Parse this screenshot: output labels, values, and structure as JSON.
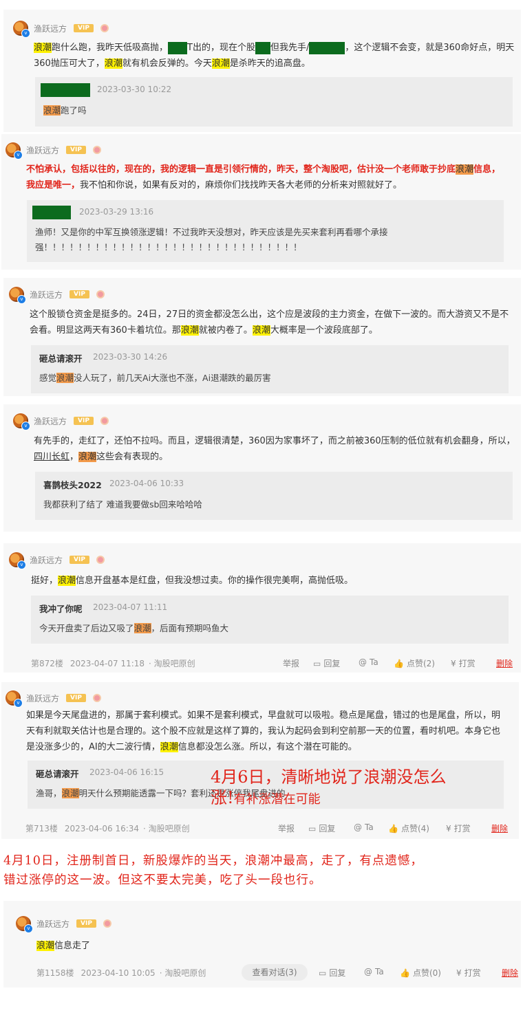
{
  "user": {
    "name": "渔跃远方",
    "vip": "VIP"
  },
  "posts": [
    {
      "body": [
        {
          "t": "浪潮",
          "s": "hl"
        },
        {
          "t": "跑什么跑，我昨天低吸高抛，"
        },
        {
          "t": "",
          "s": "censor",
          "w": 28
        },
        {
          "t": "T出的，现在个股"
        },
        {
          "t": "",
          "s": "censor",
          "w": 22
        },
        {
          "t": "但我先手/"
        },
        {
          "t": "",
          "s": "censor",
          "w": 52
        },
        {
          "t": "，这个逻辑不会变，就是360命好点，明天360抛压可大了，"
        },
        {
          "t": "浪潮",
          "s": "hl"
        },
        {
          "t": "就有机会反弹的。今天"
        },
        {
          "t": "浪潮",
          "s": "hl"
        },
        {
          "t": "是杀昨天的追高盘。"
        }
      ],
      "reply": {
        "time": "2023-03-30 10:22",
        "body": [
          {
            "t": "浪潮",
            "s": "hlo"
          },
          {
            "t": "跑了吗"
          }
        ]
      }
    },
    {
      "body": [
        {
          "t": "不怕承认，包括以往的，现在的，我的逻辑一直是引领行情的，昨天，整个淘股吧，估计没一个老师敢于抄底",
          "s": "red"
        },
        {
          "t": "浪潮",
          "s": "hlo"
        },
        {
          "t": "信息，我应是唯一，",
          "s": "red"
        },
        {
          "t": "我不怕和你说，如果有反对的，麻烦你们找找昨天各大老师的分析来对照就好了。"
        }
      ],
      "reply": {
        "time": "2023-03-29 13:16",
        "body": [
          {
            "t": "渔师！又是你的中军互换领涨逻辑！不过我昨天没想对，昨天应该是先买来套利再看哪个承接强！！！！！！！！！！！！！！！！！！！！！！！！！！！！！！"
          }
        ]
      }
    },
    {
      "body": [
        {
          "t": "这个股锁仓资金是挺多的。24日，27日的资金都没怎么出，这个应是波段的主力资金，在做下一波的。而大游资又不是不会看。明显这两天有360卡着坑位。那"
        },
        {
          "t": "浪潮",
          "s": "hl"
        },
        {
          "t": "就被内卷了。"
        },
        {
          "t": "浪潮",
          "s": "hl"
        },
        {
          "t": "大概率是一个波段底部了。"
        }
      ],
      "reply": {
        "name": "砸总请滚开",
        "time": "2023-03-30 14:26",
        "body": [
          {
            "t": "感觉"
          },
          {
            "t": "浪潮",
            "s": "hlo"
          },
          {
            "t": "没人玩了，前几天Ai大涨也不涨，Ai退潮跌的最厉害"
          }
        ]
      }
    },
    {
      "body": [
        {
          "t": "有先手的，走红了，还怕不拉吗。而且，逻辑很清楚，360因为家事坏了，而之前被360压制的低位就有机会翻身，所以，"
        },
        {
          "t": "四川长虹",
          "s": "link"
        },
        {
          "t": "，"
        },
        {
          "t": "浪潮",
          "s": "hlo"
        },
        {
          "t": "这些会有表现的。"
        }
      ],
      "reply": {
        "name": "喜鹊枝头2022",
        "time": "2023-04-06 10:33",
        "body": [
          {
            "t": "我都获利了结了 难道我要做sb回来哈哈哈"
          }
        ]
      }
    },
    {
      "body": [
        {
          "t": "挺好，"
        },
        {
          "t": "浪潮",
          "s": "hl"
        },
        {
          "t": "信息开盘基本是红盘，但我没想过卖。你的操作很完美啊，高抛低吸。"
        }
      ],
      "reply": {
        "name": "我冲了你呢",
        "time": "2023-04-07 11:11",
        "body": [
          {
            "t": "今天开盘卖了后边又吸了"
          },
          {
            "t": "浪潮",
            "s": "hlo"
          },
          {
            "t": "，后面有预期吗鱼大"
          }
        ]
      },
      "footer": {
        "floor": "第872楼",
        "time": "2023-04-07 11:18",
        "source": "· 淘股吧原创",
        "report": "举报",
        "reply": "回复",
        "at": "Ta",
        "like": "点赞(2)",
        "tip": "打赏",
        "delete": "删除"
      }
    },
    {
      "body": [
        {
          "t": "如果是今天尾盘进的，那属于套利模式。如果不是套利模式，早盘就可以吸啦。稳点是尾盘，错过的也是尾盘，所以，明天有利就取关估计也是合理的。这个股不应就是这样了算的，我认为起码会到利空前那一天的位置，看时机吧。本身它也是没涨多少的，AI的大二波行情，"
        },
        {
          "t": "浪潮",
          "s": "hl"
        },
        {
          "t": "信息都没怎么涨。所以，有这个潜在可能的。"
        }
      ],
      "reply": {
        "name": "砸总请滚开",
        "time": "2023-04-06 16:15",
        "body": [
          {
            "t": "渔哥，"
          },
          {
            "t": "浪潮",
            "s": "hlo"
          },
          {
            "t": "明天什么预期能透露一下吗？套利还是涨停我尾盘进的"
          }
        ]
      },
      "footer": {
        "floor": "第713楼",
        "time": "2023-04-06 16:34",
        "source": "· 淘股吧原创",
        "report": "举报",
        "reply": "回复",
        "at": "Ta",
        "like": "点赞(4)",
        "tip": "打赏",
        "delete": "删除"
      }
    },
    {
      "body": [
        {
          "t": "浪潮",
          "s": "hl"
        },
        {
          "t": "信息走了"
        }
      ],
      "footer": {
        "floor": "第1158楼",
        "time": "2023-04-10 10:05",
        "source": "· 淘股吧原创",
        "chat": "查看对话(3)",
        "reply": "回复",
        "at": "Ta",
        "like": "点赞(0)",
        "tip": "打赏",
        "delete": "删除"
      }
    }
  ],
  "annotations": {
    "a1_line1": "4月6日，清晰地说了浪潮没怎么",
    "a1_line2a": "涨!",
    "a1_line2b": "有补涨潜在可能",
    "a2_line1": "4月10日，注册制首日，新股爆炸的当天，浪潮冲最高，走了，有点遗憾，",
    "a2_line2": "错过涨停的这一波。但这不要太完美，吃了头一段也行。"
  },
  "colors": {
    "highlight": "#fff200",
    "highlight_orange": "#f39a4a",
    "accent_red": "#e1251b",
    "censor": "#0c6b1e",
    "vip": "#f5c252"
  }
}
